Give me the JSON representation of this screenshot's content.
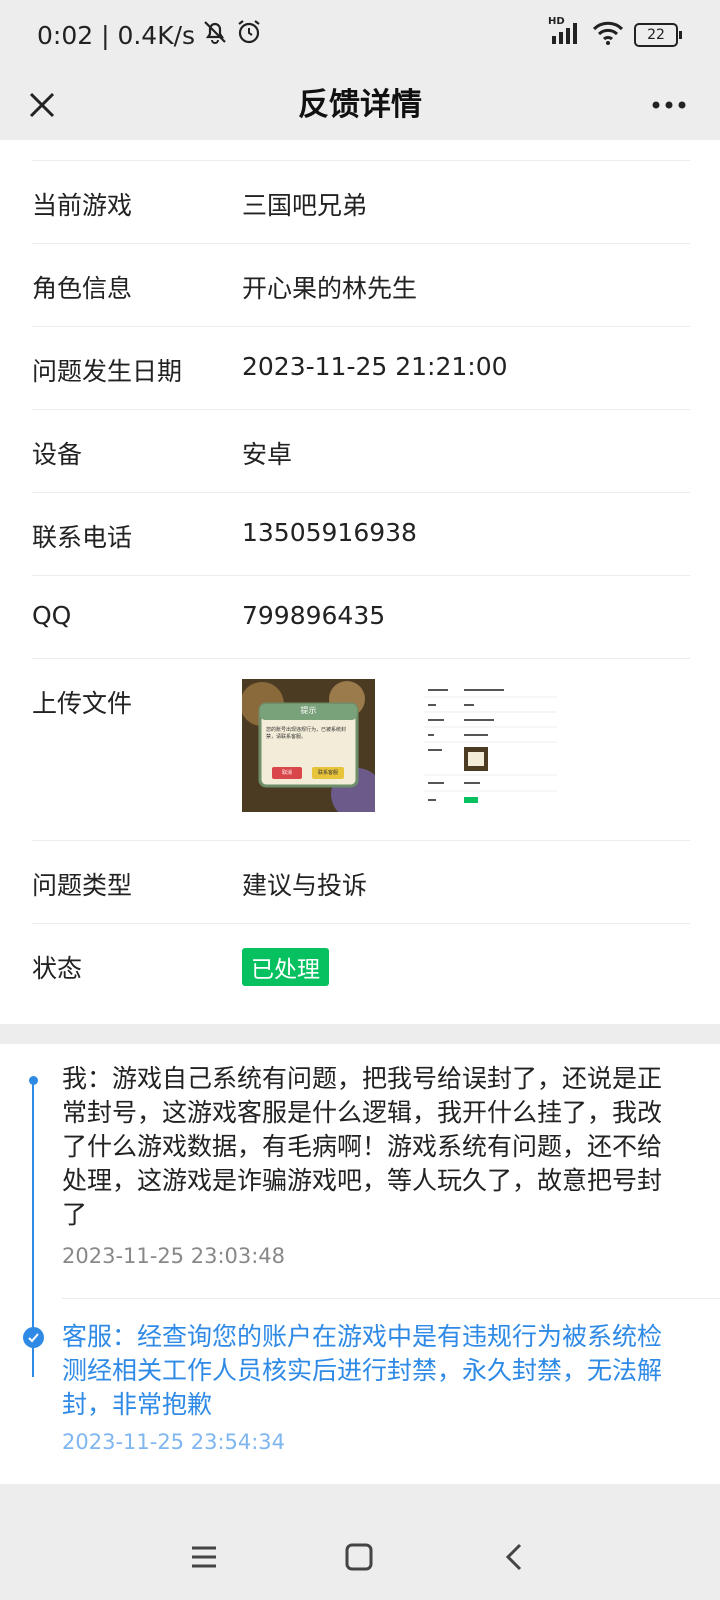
{
  "status_bar": {
    "time_speed": "0:02 | 0.4K/s",
    "battery": "22",
    "network": "HD"
  },
  "nav": {
    "title": "反馈详情"
  },
  "rows": [
    {
      "label": "当前游戏",
      "value": "三国吧兄弟"
    },
    {
      "label": "角色信息",
      "value": "开心果的林先生"
    },
    {
      "label": "问题发生日期",
      "value": "2023-11-25 21:21:00"
    },
    {
      "label": "设备",
      "value": "安卓"
    },
    {
      "label": "联系电话",
      "value": "13505916938"
    },
    {
      "label": "QQ",
      "value": "799896435"
    }
  ],
  "upload": {
    "label": "上传文件",
    "thumb1_title": "提示",
    "thumb1_text": "您的账号出现违规行为，已被系统封禁，请联系客服。",
    "thumb1_btn_left": "取消",
    "thumb1_btn_right": "联系客服"
  },
  "type_row": {
    "label": "问题类型",
    "value": "建议与投诉"
  },
  "status_row": {
    "label": "状态",
    "badge": "已处理"
  },
  "conversation": {
    "user_message": "我：游戏自己系统有问题，把我号给误封了，还说是正常封号，这游戏客服是什么逻辑，我开什么挂了，我改了什么游戏数据，有毛病啊！游戏系统有问题，还不给处理，这游戏是诈骗游戏吧，等人玩久了，故意把号封了",
    "user_time": "2023-11-25 23:03:48",
    "reply_message": "客服：经查询您的账户在游戏中是有违规行为被系统检测经相关工作人员核实后进行封禁，永久封禁，无法解封，非常抱歉",
    "reply_time": "2023-11-25 23:54:34"
  },
  "colors": {
    "accent_blue": "#2f8ae6",
    "badge_green": "#07c160"
  }
}
